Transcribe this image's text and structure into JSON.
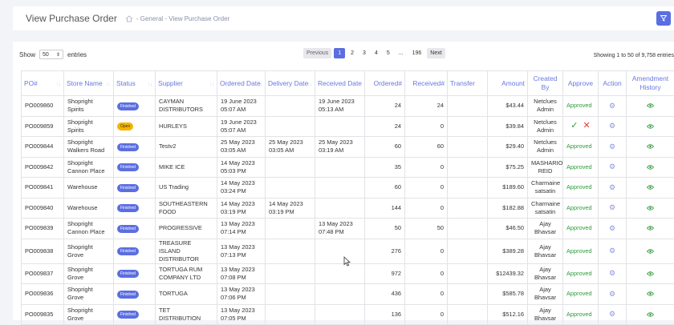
{
  "header": {
    "title": "View Purchase Order",
    "breadcrumb": "- General - View Purchase Order"
  },
  "controls": {
    "show_label": "Show",
    "page_size": "50",
    "entries_label": "entries",
    "showing": "Showing 1 to 50 of 9,758 entries"
  },
  "pagination": {
    "previous": "Previous",
    "pages": [
      "1",
      "2",
      "3",
      "4",
      "5",
      "...",
      "196"
    ],
    "active_page": "1",
    "next": "Next"
  },
  "colors": {
    "accent": "#5b6ee1",
    "finished": "#5b6ee1",
    "open": "#f5b400",
    "approved": "#2e9b3a"
  },
  "table": {
    "columns": [
      "PO#",
      "Store Name",
      "Status",
      "Supplier",
      "Ordered Date",
      "Delivery Date",
      "Received Date",
      "Ordered#",
      "Received#",
      "Transfer",
      "Amount",
      "Created By",
      "Approve",
      "Action",
      "Amendment History"
    ],
    "rows": [
      {
        "po": "PO009860",
        "store": "Shopright Spirits",
        "status": "Finished",
        "supplier": "CAYMAN DISTRIBUTORS",
        "ordered": "19 June 2023 05:07 AM",
        "delivery": "",
        "received_date": "19 June 2023 05:13 AM",
        "ordered_qty": "24",
        "received_qty": "24",
        "transfer": "",
        "amount": "$43.44",
        "created_by": "Netclues Admin",
        "approve": "Approved"
      },
      {
        "po": "PO009859",
        "store": "Shopright Spirits",
        "status": "Open",
        "supplier": "HURLEYS",
        "ordered": "19 June 2023 05:07 AM",
        "delivery": "",
        "received_date": "",
        "ordered_qty": "24",
        "received_qty": "0",
        "transfer": "",
        "amount": "$39.84",
        "created_by": "Netclues Admin",
        "approve": ""
      },
      {
        "po": "PO009844",
        "store": "Shopright Walkers Road",
        "status": "Finished",
        "supplier": "Testv2",
        "ordered": "25 May 2023 03:05 AM",
        "delivery": "25 May 2023 03:05 AM",
        "received_date": "25 May 2023 03:19 AM",
        "ordered_qty": "60",
        "received_qty": "60",
        "transfer": "",
        "amount": "$29.40",
        "created_by": "Netclues Admin",
        "approve": "Approved"
      },
      {
        "po": "PO009842",
        "store": "Shopright Cannon Place",
        "status": "Finished",
        "supplier": "MIKE ICE",
        "ordered": "14 May 2023 05:03 PM",
        "delivery": "",
        "received_date": "",
        "ordered_qty": "35",
        "received_qty": "0",
        "transfer": "",
        "amount": "$75.25",
        "created_by": "MASHARIO REID",
        "approve": "Approved"
      },
      {
        "po": "PO009841",
        "store": "Warehouse",
        "status": "Finished",
        "supplier": "US Trading",
        "ordered": "14 May 2023 03:24 PM",
        "delivery": "",
        "received_date": "",
        "ordered_qty": "60",
        "received_qty": "0",
        "transfer": "",
        "amount": "$189.60",
        "created_by": "Charmaine satsatin",
        "approve": "Approved"
      },
      {
        "po": "PO009840",
        "store": "Warehouse",
        "status": "Finished",
        "supplier": "SOUTHEASTERN FOOD",
        "ordered": "14 May 2023 03:19 PM",
        "delivery": "14 May 2023 03:19 PM",
        "received_date": "",
        "ordered_qty": "144",
        "received_qty": "0",
        "transfer": "",
        "amount": "$182.88",
        "created_by": "Charmaine satsatin",
        "approve": "Approved"
      },
      {
        "po": "PO009839",
        "store": "Shopright Cannon Place",
        "status": "Finished",
        "supplier": "PROGRESSIVE",
        "ordered": "13 May 2023 07:14 PM",
        "delivery": "",
        "received_date": "13 May 2023 07:48 PM",
        "ordered_qty": "50",
        "received_qty": "50",
        "transfer": "",
        "amount": "$46.50",
        "created_by": "Ajay Bhavsar",
        "approve": "Approved"
      },
      {
        "po": "PO009838",
        "store": "Shopright Grove",
        "status": "Finished",
        "supplier": "TREASURE ISLAND DISTRIBUTOR",
        "ordered": "13 May 2023 07:13 PM",
        "delivery": "",
        "received_date": "",
        "ordered_qty": "276",
        "received_qty": "0",
        "transfer": "",
        "amount": "$389.28",
        "created_by": "Ajay Bhavsar",
        "approve": "Approved"
      },
      {
        "po": "PO009837",
        "store": "Shopright Grove",
        "status": "Finished",
        "supplier": "TORTUGA RUM COMPANY LTD",
        "ordered": "13 May 2023 07:08 PM",
        "delivery": "",
        "received_date": "",
        "ordered_qty": "972",
        "received_qty": "0",
        "transfer": "",
        "amount": "$12439.32",
        "created_by": "Ajay Bhavsar",
        "approve": "Approved"
      },
      {
        "po": "PO009836",
        "store": "Shopright Grove",
        "status": "Finished",
        "supplier": "TORTUGA",
        "ordered": "13 May 2023 07:06 PM",
        "delivery": "",
        "received_date": "",
        "ordered_qty": "436",
        "received_qty": "0",
        "transfer": "",
        "amount": "$585.78",
        "created_by": "Ajay Bhavsar",
        "approve": "Approved"
      },
      {
        "po": "PO009835",
        "store": "Shopright Grove",
        "status": "Finished",
        "supplier": "TET DISTRIBUTION",
        "ordered": "13 May 2023 07:05 PM",
        "delivery": "",
        "received_date": "",
        "ordered_qty": "136",
        "received_qty": "0",
        "transfer": "",
        "amount": "$512.16",
        "created_by": "Ajay Bhavsar",
        "approve": "Approved"
      }
    ]
  }
}
